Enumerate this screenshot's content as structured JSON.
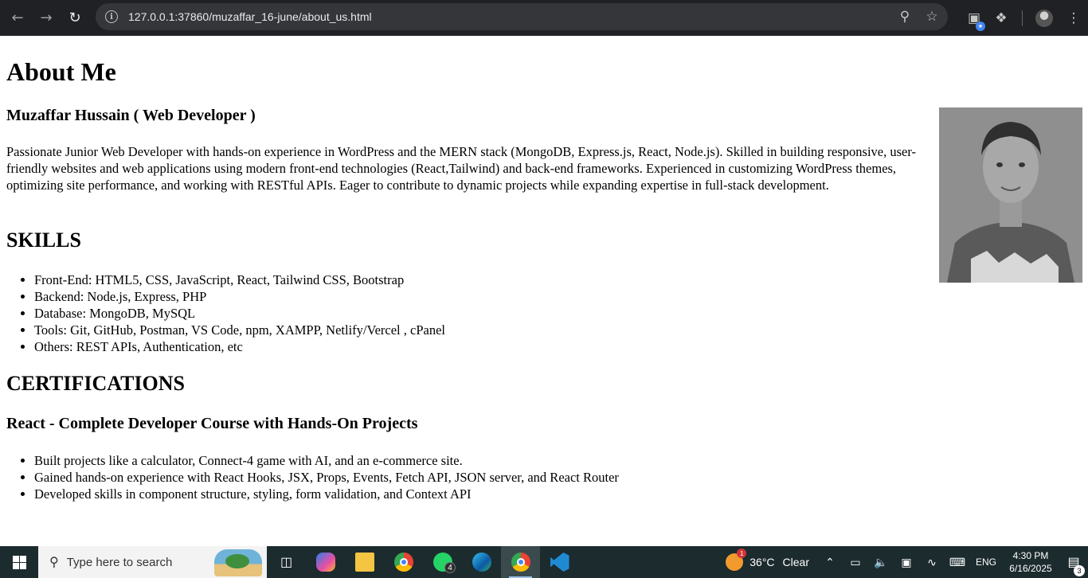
{
  "browser": {
    "url": "127.0.0.1:37860/muzaffar_16-june/about_us.html",
    "back_icon": "arrow-left-icon",
    "forward_icon": "arrow-right-icon",
    "reload_icon": "reload-icon",
    "info_icon": "site-info-icon",
    "zoom_icon": "zoom-icon",
    "bookmark_icon": "star-icon",
    "tab_search_icon": "tab-search-icon",
    "extensions_icon": "puzzle-icon",
    "menu_icon": "kebab-menu-icon"
  },
  "page": {
    "title": "About Me",
    "name_heading": "Muzaffar Hussain ( Web Developer )",
    "bio": "Passionate Junior Web Developer with hands-on experience in WordPress and the MERN stack (MongoDB, Express.js, React, Node.js). Skilled in building responsive, user-friendly websites and web applications using modern front-end technologies (React,Tailwind) and back-end frameworks. Experienced in customizing WordPress themes, optimizing site performance, and working with RESTful APIs. Eager to contribute to dynamic projects while expanding expertise in full-stack development.",
    "skills_heading": "SKILLS",
    "skills": [
      "Front-End: HTML5, CSS, JavaScript, React, Tailwind CSS, Bootstrap",
      "Backend: Node.js, Express, PHP",
      "Database: MongoDB, MySQL",
      "Tools: Git, GitHub, Postman, VS Code, npm, XAMPP, Netlify/Vercel , cPanel",
      "Others: REST APIs, Authentication, etc"
    ],
    "certifications_heading": "CERTIFICATIONS",
    "course_heading": "React - Complete Developer Course with Hands-On Projects",
    "course_points": [
      "Built projects like a calculator, Connect-4 game with AI, and an e-commerce site.",
      "Gained hands-on experience with React Hooks, JSX, Props, Events, Fetch API, JSON server, and React Router",
      "Developed skills in component structure, styling, form validation, and Context API"
    ]
  },
  "taskbar": {
    "search_placeholder": "Type here to search",
    "whatsapp_badge": "4",
    "weather_temp": "36°C",
    "weather_cond": "Clear",
    "weather_badge": "1",
    "language": "ENG",
    "time": "4:30 PM",
    "date": "6/16/2025",
    "notification_count": "3"
  }
}
